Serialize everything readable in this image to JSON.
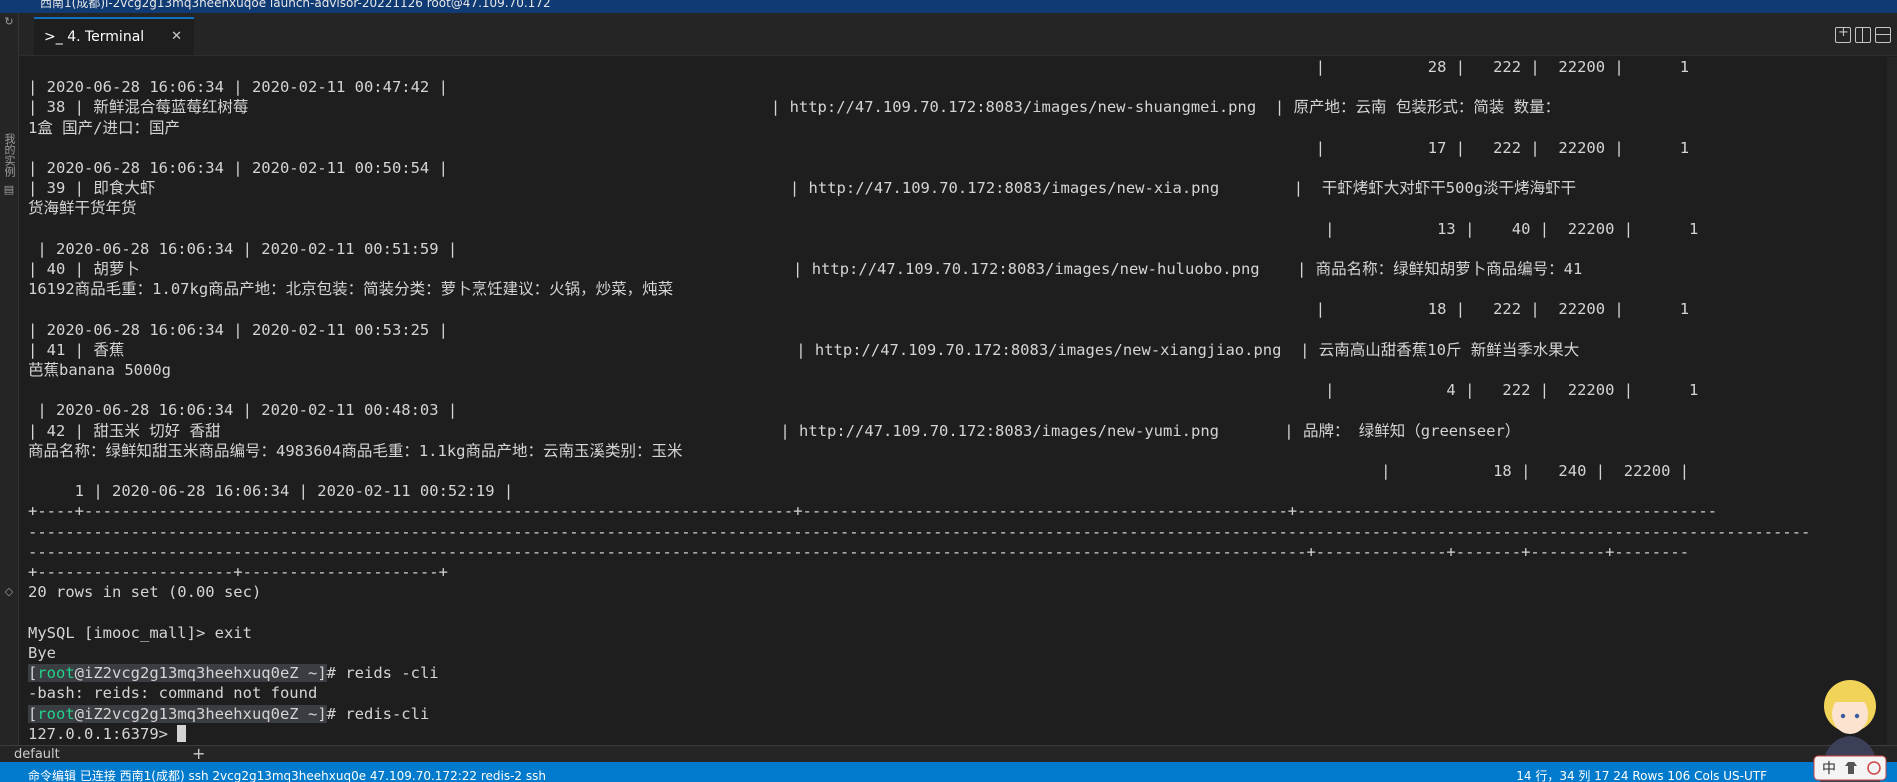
{
  "window": {
    "title": "西南1(成都)i-2vcg2g13mq3heehxuqoe    launch-advisor-20221126    root@47.109.70.172"
  },
  "activity_bar": {
    "label": "我的实例"
  },
  "tab": {
    "icon": ">_",
    "label": "4. Terminal",
    "close": "✕"
  },
  "terminal": {
    "prompt_user": "root",
    "prompt_host": "@iZ2vcg2g13mq3heehxuq0eZ ~",
    "lines": [
      "                                                                                                                                          |           28 |   222 |  22200 |      1",
      "| 2020-06-28 16:06:34 | 2020-02-11 00:47:42 |",
      "| 38 | 新鲜混合莓蓝莓红树莓                                                        | http://47.109.70.172:8083/images/new-shuangmei.png  | 原产地：云南 包装形式：简装 数量：",
      "1盒 国产/进口：国产",
      "                                                                                                                                          |           17 |   222 |  22200 |      1",
      "| 2020-06-28 16:06:34 | 2020-02-11 00:50:54 |",
      "| 39 | 即食大虾                                                                    | http://47.109.70.172:8083/images/new-xia.png        |  干虾烤虾大对虾干500g淡干烤海虾干",
      "货海鲜干货年货",
      "                                                                                                                                           |           13 |    40 |  22200 |      1",
      " | 2020-06-28 16:06:34 | 2020-02-11 00:51:59 |",
      "| 40 | 胡萝卜                                                                      | http://47.109.70.172:8083/images/new-huluobo.png    | 商品名称：绿鲜知胡萝卜商品编号：41",
      "16192商品毛重：1.07kg商品产地：北京包装：简装分类：萝卜烹饪建议：火锅，炒菜，炖菜",
      "                                                                                                                                          |           18 |   222 |  22200 |      1",
      "| 2020-06-28 16:06:34 | 2020-02-11 00:53:25 |",
      "| 41 | 香蕉                                                                        | http://47.109.70.172:8083/images/new-xiangjiao.png  | 云南高山甜香蕉10斤 新鲜当季水果大",
      "芭蕉banana 5000g",
      "                                                                                                                                           |            4 |   222 |  22200 |      1",
      " | 2020-06-28 16:06:34 | 2020-02-11 00:48:03 |",
      "| 42 | 甜玉米 切好 香甜                                                            | http://47.109.70.172:8083/images/new-yumi.png       | 品牌： 绿鲜知（greenseer）",
      "商品名称：绿鲜知甜玉米商品编号：4983604商品毛重：1.1kg商品产地：云南玉溪类别：玉米",
      "                                                                                                                                                 |           18 |   240 |  22200 |",
      "     1 | 2020-06-28 16:06:34 | 2020-02-11 00:52:19 |",
      "+----+----------------------------------------------------------------------------+----------------------------------------------------+---------------------------------------------",
      "-----------------------------------------------------------------------------------------------------------------------------------------------------------------------------------------------",
      "-----------------------------------------------------------------------------------------------------------------------------------------+--------------+-------+--------+--------",
      "+---------------------+---------------------+",
      "20 rows in set (0.00 sec)",
      "",
      "MySQL [imooc_mall]> exit",
      "Bye"
    ],
    "cmd1": "# reids -cli",
    "err1": "-bash: reids: command not found",
    "cmd2": "# redis-cli",
    "redis_prompt": "127.0.0.1:6379> "
  },
  "panel": {
    "profile": "default",
    "add": "+"
  },
  "statusbar": {
    "left": "命令编辑    已连接    西南1(成都)  ssh  2vcg2g13mq3heehxuq0e   47.109.70.172:22    redis-2  ssh",
    "right": "14 行，34 列    17    24 Rows    106 Cols    US-UTF"
  },
  "mascot": {
    "badge": "中"
  }
}
